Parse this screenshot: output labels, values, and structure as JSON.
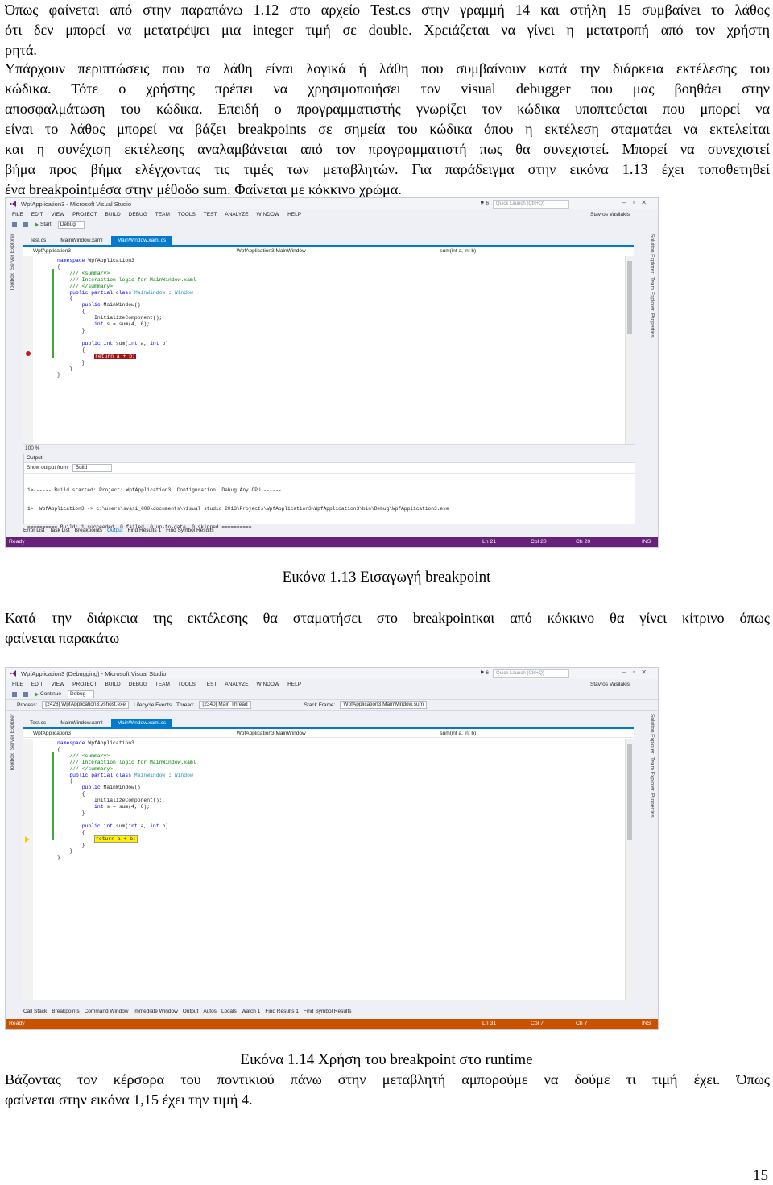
{
  "para1": [
    "Όπως φαίνεται από στην παραπάνω 1.12 στο αρχείο Test.cs στην γραμμή 14 και στήλη 15 συμβαίνει το λάθος",
    "ότι δεν μπορεί να μετατρέψει μια integer τιμή σε double. Χρειάζεται να γίνει η μετατροπή από τον χρήστη",
    "ρητά."
  ],
  "para2": [
    " Υπάρχουν περιπτώσεις που τα λάθη είναι λογικά ή λάθη που συμβαίνουν κατά την διάρκεια εκτέλεσης του",
    "κώδικα. Τότε ο χρήστης πρέπει να χρησιμοποιήσει τον visual debugger που μας   βοηθάει στην",
    "αποσφαλμάτωση του κώδικα. Επειδή ο προγραμματιστής γνωρίζει τον κώδικα υποπτεύεται που μπορεί να",
    "είναι το λάθος μπορεί να βάζει breakpoints σε σημεία του κώδικα όπου η εκτέλεση σταματάει να εκτελείται",
    "και η συνέχιση εκτέλεσης αναλαμβάνεται από τον προγραμματιστή πως θα συνεχιστεί. Μπορεί να συνεχιστεί",
    "βήμα προς βήμα ελέγχοντας τις τιμές των μεταβλητών. Για παράδειγμα στην εικόνα 1.13 έχει τοποθετηθεί",
    "ένα breakpointμέσα στην μέθοδο sum. Φαίνεται με κόκκινο χρώμα."
  ],
  "caption1": "Εικόνα 1.13 Εισαγωγή breakpoint",
  "para3": [
    " Κατά την διάρκεια της εκτέλεσης θα σταματήσει στο breakpointκαι από κόκκινο θα γίνει κίτρινο όπως",
    "φαίνεται παρακάτω"
  ],
  "caption2": "Εικόνα 1.14 Χρήση του breakpoint στο runtime",
  "para4": [
    " Βάζοντας τον κέρσορα του ποντικιού πάνω στην μεταβλητή αμπορούμε να δούμε τι τιμή έχει. Όπως",
    "φαίνεται στην εικόνα 1,15 έχει την τιμή 4."
  ],
  "page_number": "15",
  "shot1": {
    "title": "WpfApplication3 - Microsoft Visual Studio",
    "quick_launch": "Quick Launch (Ctrl+Q)",
    "flag_count": "6",
    "menu": [
      "FILE",
      "EDIT",
      "VIEW",
      "PROJECT",
      "BUILD",
      "DEBUG",
      "TEAM",
      "TOOLS",
      "TEST",
      "ANALYZE",
      "WINDOW",
      "HELP"
    ],
    "user": "Stavros Vasilakis",
    "start_label": "Start",
    "config": "Debug",
    "left_side": [
      "Server Explorer",
      "Toolbox"
    ],
    "right_side": [
      "Solution Explorer",
      "Team Explorer",
      "Properties"
    ],
    "tabs": [
      "Test.cs",
      "MainWindow.xaml",
      "MainWindow.xaml.cs"
    ],
    "nav_left": "WpfApplication3",
    "nav_mid": "WpfApplication3.MainWindow",
    "nav_right": "sum(int a, int b)",
    "code": [
      "namespace WpfApplication3",
      "{",
      "    /// <summary>",
      "    /// Interaction logic for MainWindow.xaml",
      "    /// </summary>",
      "    public partial class MainWindow : Window",
      "    {",
      "        public MainWindow()",
      "        {",
      "            InitializeComponent();",
      "            int s = sum(4, 6);",
      "        }",
      "        public int sum(int a, int b)",
      "        {",
      "            return a + b;",
      "        }",
      "    }",
      "}"
    ],
    "zoom": "100 %",
    "output_title": "Output",
    "output_from_label": "Show output from:",
    "output_from_value": "Build",
    "output_lines": [
      "1>------ Build started: Project: WpfApplication3, Configuration: Debug Any CPU ------",
      "1>  WpfApplication3 -> c:\\users\\svasi_000\\documents\\visual studio 2013\\Projects\\WpfApplication3\\WpfApplication3\\bin\\Debug\\WpfApplication3.exe",
      "========== Build: 1 succeeded, 0 failed, 0 up-to-date, 0 skipped =========="
    ],
    "bottom_tabs": [
      "Error List",
      "Task List",
      "Breakpoints",
      "Output",
      "Find Results 1",
      "Find Symbol Results"
    ],
    "status": "Ready",
    "ln": "Ln 21",
    "col": "Col 20",
    "ch": "Ch 20",
    "ins": "INS",
    "status_color": "#68217a"
  },
  "shot2": {
    "title": "WpfApplication3 (Debugging) - Microsoft Visual Studio",
    "quick_launch": "Quick Launch (Ctrl+Q)",
    "flag_count": "6",
    "menu": [
      "FILE",
      "EDIT",
      "VIEW",
      "PROJECT",
      "BUILD",
      "DEBUG",
      "TEAM",
      "TOOLS",
      "TEST",
      "ANALYZE",
      "WINDOW",
      "HELP"
    ],
    "user": "Stavros Vasilakis",
    "continue_label": "Continue",
    "config": "Debug",
    "process_label": "Process:",
    "process_value": "[2428] WpfApplication3.vshost.exe",
    "lifecycle": "Lifecycle Events",
    "thread_label": "Thread:",
    "thread_value": "[2340] Main Thread",
    "stack_label": "Stack Frame:",
    "stack_value": "WpfApplication3.MainWindow.sum",
    "left_side": [
      "Server Explorer",
      "Toolbox"
    ],
    "right_side": [
      "Solution Explorer",
      "Team Explorer",
      "Properties"
    ],
    "tabs": [
      "Test.cs",
      "MainWindow.xaml",
      "MainWindow.xaml.cs"
    ],
    "nav_left": "WpfApplication3",
    "nav_mid": "WpfApplication3.MainWindow",
    "nav_right": "sum(int a, int b)",
    "code": [
      "namespace WpfApplication3",
      "{",
      "    /// <summary>",
      "    /// Interaction logic for MainWindow.xaml",
      "    /// </summary>",
      "    public partial class MainWindow : Window",
      "    {",
      "        public MainWindow()",
      "        {",
      "            InitializeComponent();",
      "            int s = sum(4, 6);",
      "        }",
      "        public int sum(int a, int b)",
      "        {",
      "            return a + b;",
      "        }",
      "    }",
      "}"
    ],
    "bottom_tabs": [
      "Call Stack",
      "Breakpoints",
      "Command Window",
      "Immediate Window",
      "Output",
      "Autos",
      "Locals",
      "Watch 1",
      "Find Results 1",
      "Find Symbol Results"
    ],
    "status": "Ready",
    "ln": "Ln 31",
    "col": "Col 7",
    "ch": "Ch 7",
    "ins": "INS",
    "status_color": "#ca5100"
  }
}
